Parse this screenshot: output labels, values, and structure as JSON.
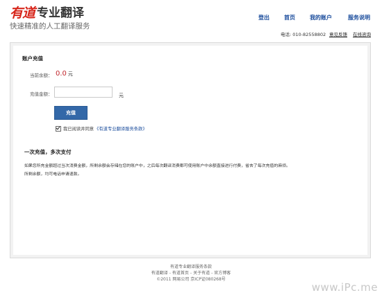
{
  "brand": {
    "logo_mark": "有道",
    "logo_text": "专业翻译",
    "tagline": "快速精准的人工翻译服务"
  },
  "nav": {
    "items": [
      {
        "label": "登出"
      },
      {
        "label": "首页"
      },
      {
        "label": "我的账户"
      },
      {
        "label": "服务说明"
      }
    ]
  },
  "subnav": {
    "phone_label": "电话:",
    "phone_number": "010-82558802",
    "links": [
      {
        "label": "意见反馈"
      },
      {
        "label": "在线咨询"
      }
    ]
  },
  "recharge": {
    "title": "账户充值",
    "balance_label": "当前余额：",
    "balance_value": "0.0",
    "balance_unit": "元",
    "amount_label": "充值金额：",
    "amount_value": "",
    "amount_placeholder": "",
    "amount_unit": "元",
    "submit_label": "充值",
    "agree_text": "我已阅读并同意",
    "agree_link": "《有道专业翻译服务条款》"
  },
  "info": {
    "title": "一次充值，多次支付",
    "lines": [
      "如果您所充金额超过当次消费金额，所剩余额会存储在您的账户中，之后每次翻译消费都可使用账户中余额直接进行付费，省去了每次充值的麻烦。",
      "所剩余额，均可电话申请退款。"
    ]
  },
  "footer": {
    "terms": "有道专业翻译服务条款",
    "links": [
      "有道翻译",
      "有道首页",
      "关于有道",
      "官方博客"
    ],
    "separator": "-",
    "copyright": "©2011 网易公司 京ICP证080268号"
  },
  "watermark": "www.iPc.me",
  "colors": {
    "brand_red": "#d7261b",
    "nav_blue": "#1a4c9c",
    "button_blue": "#3368a8",
    "balance_red": "#c1272d"
  }
}
